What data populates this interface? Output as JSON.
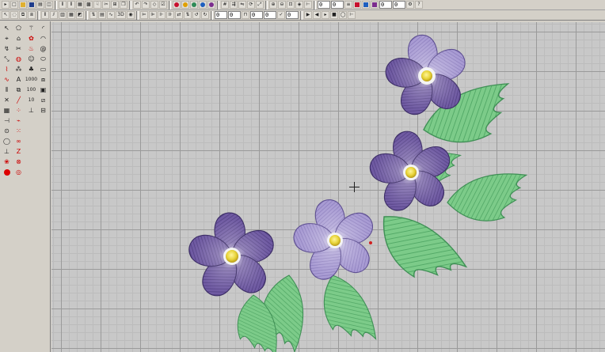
{
  "window": {
    "hint": "embroidery design editor"
  },
  "toolbar_top": {
    "zoom_fields": [
      "0",
      "0",
      "0",
      "0"
    ],
    "color_swatches": [
      "#c8102e",
      "#e0a000",
      "#2e8b57",
      "#1e5fbf",
      "#7b2d8e"
    ]
  },
  "toolbar_second": {
    "label_3d": "3D",
    "number_fields": [
      "0",
      "0",
      "0",
      "0",
      "0"
    ]
  },
  "left_tools": {
    "labels": [
      "A",
      "1000",
      "100",
      "10"
    ]
  },
  "design": {
    "petal_color_dark": "#5e4a8c",
    "petal_color_light": "#a79ad0",
    "center_color": "#e8d43a",
    "leaf_color": "#7fcf8c",
    "leaf_color_dark": "#4ea865"
  }
}
